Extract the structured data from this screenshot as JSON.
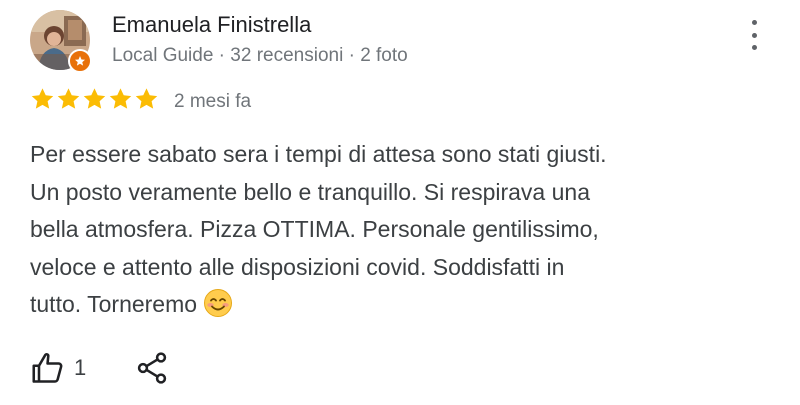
{
  "review": {
    "reviewer": {
      "name": "Emanuela Finistrella",
      "meta": "Local Guide · 32 recensioni · 2 foto",
      "avatar": "reviewer-photo",
      "badge_icon": "local-guide-star-badge"
    },
    "rating": 5,
    "rating_max": 5,
    "date": "2 mesi fa",
    "text_lines": [
      "Per essere sabato sera i tempi di attesa sono stati giusti.",
      "Un posto veramente bello e tranquillo. Si respirava una",
      "bella atmosfera. Pizza OTTIMA. Personale gentilissimo,",
      "veloce e attento alle disposizioni covid. Soddisfatti in",
      "tutto. Torneremo"
    ],
    "emoji": "smiling-face-emoji",
    "actions": {
      "like_icon": "thumbs-up-icon",
      "like_count": "1",
      "share_icon": "share-icon",
      "more_icon": "more-vert-icon"
    }
  },
  "colors": {
    "star": "#fbbc04",
    "badge": "#e8710a",
    "name": "#202124",
    "secondary_text": "#70757a",
    "body_text": "#3c4043"
  }
}
